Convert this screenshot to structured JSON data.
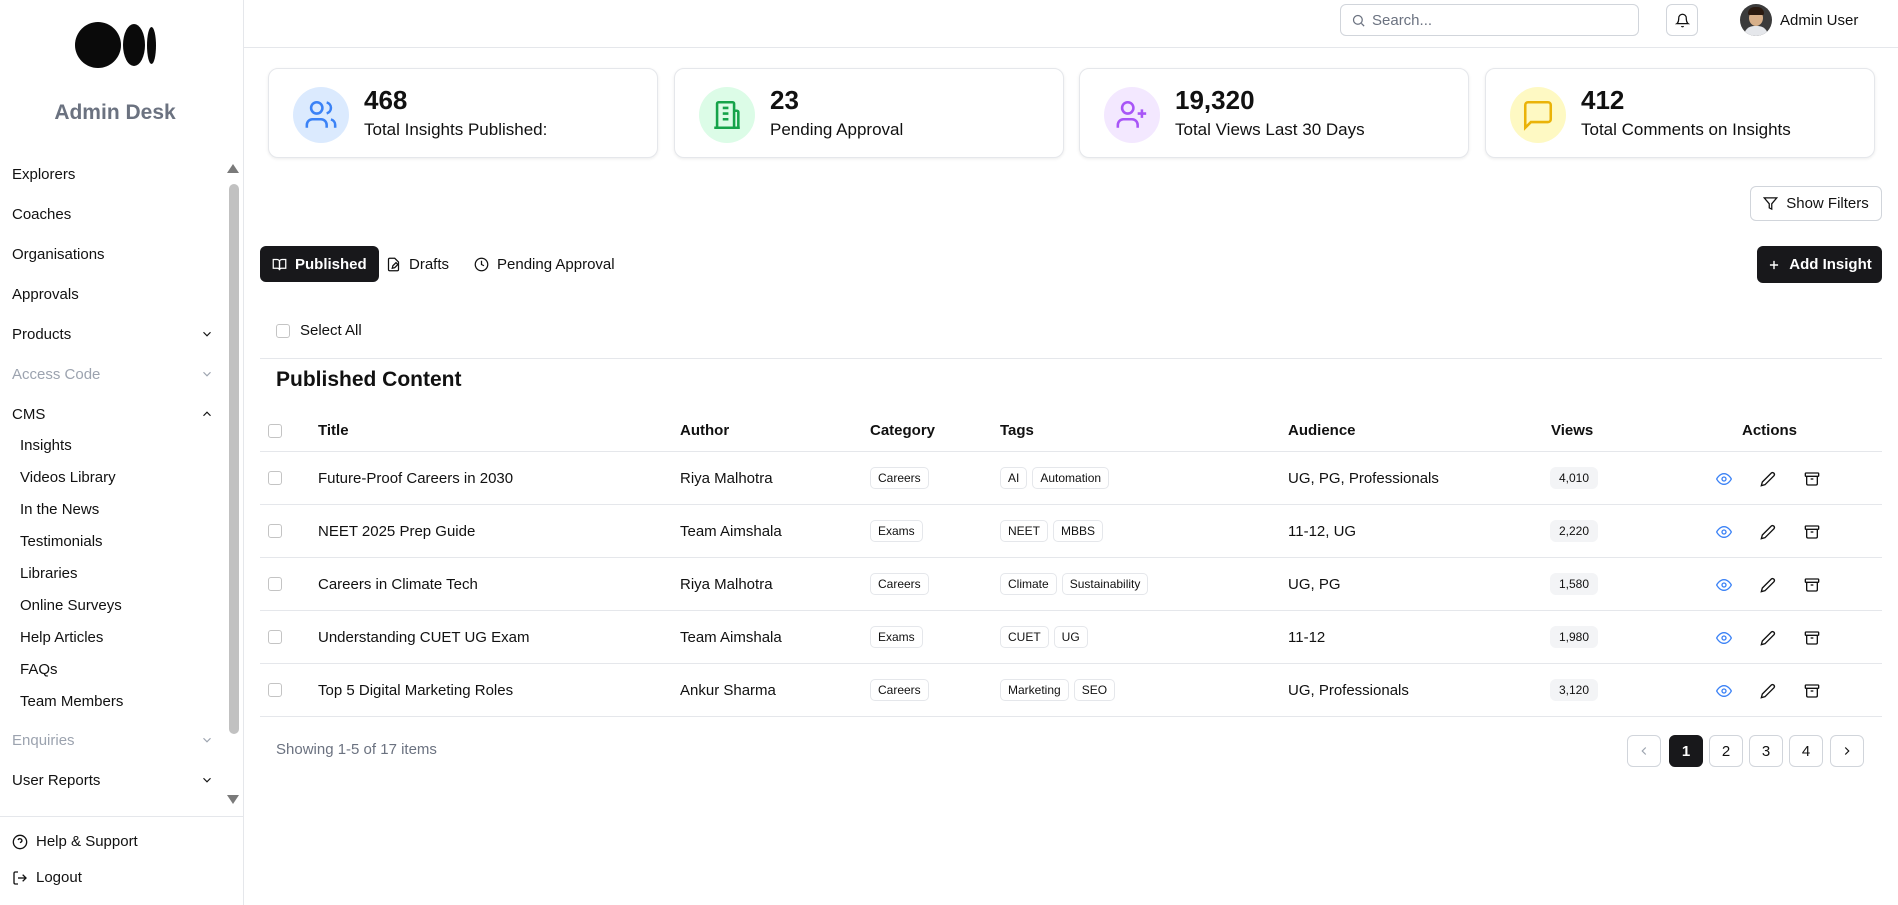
{
  "sidebar": {
    "brand": "Admin Desk",
    "items": [
      {
        "label": "Explorers"
      },
      {
        "label": "Coaches"
      },
      {
        "label": "Organisations"
      },
      {
        "label": "Approvals"
      },
      {
        "label": "Products"
      },
      {
        "label": "Access Code"
      },
      {
        "label": "CMS"
      },
      {
        "label": "Enquiries"
      },
      {
        "label": "User Reports"
      }
    ],
    "cms_items": [
      {
        "label": "Insights"
      },
      {
        "label": "Videos Library"
      },
      {
        "label": "In the News"
      },
      {
        "label": "Testimonials"
      },
      {
        "label": "Libraries"
      },
      {
        "label": "Online Surveys"
      },
      {
        "label": "Help Articles"
      },
      {
        "label": "FAQs"
      },
      {
        "label": "Team Members"
      }
    ],
    "footer": {
      "help": "Help & Support",
      "logout": "Logout"
    }
  },
  "header": {
    "search_placeholder": "Search...",
    "user_name": "Admin User"
  },
  "stats": [
    {
      "value": "468",
      "label": "Total Insights Published:",
      "color": "#3b82f6",
      "bg": "#dbeafe",
      "icon": "users-icon"
    },
    {
      "value": "23",
      "label": "Pending Approval",
      "color": "#16a34a",
      "bg": "#dcfce7",
      "icon": "building-icon"
    },
    {
      "value": "19,320",
      "label": "Total Views Last 30 Days",
      "color": "#a855f7",
      "bg": "#f3e8ff",
      "icon": "user-plus-icon"
    },
    {
      "value": "412",
      "label": "Total Comments on Insights",
      "color": "#eab308",
      "bg": "#fef9c3",
      "icon": "message-square-icon"
    }
  ],
  "toolbar": {
    "show_filters": "Show Filters",
    "add_insight": "Add Insight"
  },
  "tabs": [
    {
      "label": "Published",
      "active": true
    },
    {
      "label": "Drafts"
    },
    {
      "label": "Pending Approval"
    }
  ],
  "select_all": "Select All",
  "section_title": "Published Content",
  "table": {
    "headers": {
      "title": "Title",
      "author": "Author",
      "category": "Category",
      "tags": "Tags",
      "audience": "Audience",
      "views": "Views",
      "actions": "Actions"
    },
    "rows": [
      {
        "title": "Future-Proof Careers in 2030",
        "author": "Riya Malhotra",
        "category": "Careers",
        "tags": [
          "AI",
          "Automation"
        ],
        "audience": "UG, PG, Professionals",
        "views": "4,010"
      },
      {
        "title": "NEET 2025 Prep Guide",
        "author": "Team Aimshala",
        "category": "Exams",
        "tags": [
          "NEET",
          "MBBS"
        ],
        "audience": "11-12, UG",
        "views": "2,220"
      },
      {
        "title": "Careers in Climate Tech",
        "author": "Riya Malhotra",
        "category": "Careers",
        "tags": [
          "Climate",
          "Sustainability"
        ],
        "audience": "UG, PG",
        "views": "1,580"
      },
      {
        "title": "Understanding CUET UG Exam",
        "author": "Team Aimshala",
        "category": "Exams",
        "tags": [
          "CUET",
          "UG"
        ],
        "audience": "11-12",
        "views": "1,980"
      },
      {
        "title": "Top 5 Digital Marketing Roles",
        "author": "Ankur Sharma",
        "category": "Careers",
        "tags": [
          "Marketing",
          "SEO"
        ],
        "audience": "UG, Professionals",
        "views": "3,120"
      }
    ]
  },
  "pagination": {
    "summary": "Showing 1-5 of 17 items",
    "pages": [
      "1",
      "2",
      "3",
      "4"
    ],
    "current": "1"
  },
  "colors": {
    "accent_dark": "#18181b",
    "view_icon": "#3b82f6"
  }
}
